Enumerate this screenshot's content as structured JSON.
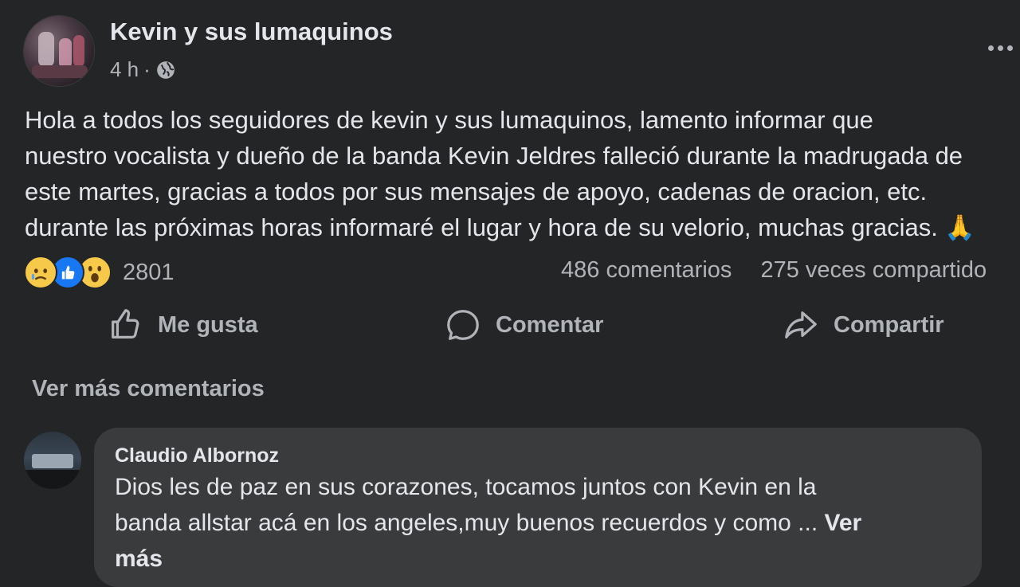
{
  "post": {
    "author": "Kevin y sus lumaquinos",
    "time": "4 h",
    "separator": "·",
    "audience_icon": "globe-icon",
    "more_icon": "ellipsis-icon",
    "text_lines": [
      "Hola a todos los seguidores de kevin y sus lumaquinos, lamento informar que",
      "nuestro vocalista y dueño de la banda Kevin Jeldres falleció durante la madrugada de",
      "este martes, gracias a todos por sus mensajes de apoyo, cadenas de oracion, etc.",
      "durante las próximas horas informaré el lugar y hora de su velorio, muchas gracias. 🙏"
    ]
  },
  "reactions": {
    "icons": [
      "sad-emoji",
      "like-icon",
      "wow-emoji"
    ],
    "count": "2801",
    "comments": "486 comentarios",
    "shares": "275 veces compartido"
  },
  "actions": {
    "like": "Me gusta",
    "comment": "Comentar",
    "share": "Compartir"
  },
  "comments_section": {
    "more_comments": "Ver más comentarios",
    "comment": {
      "author": "Claudio Albornoz",
      "line1": "Dios les de paz en sus corazones, tocamos juntos con Kevin en la",
      "line2": "banda allstar acá en los angeles,muy buenos recuerdos y como ... ",
      "see_more_part1": "Ver",
      "see_more_part2": "más"
    }
  },
  "colors": {
    "background": "#242526",
    "text_primary": "#e4e6eb",
    "text_secondary": "#b0b3b8",
    "bubble": "#3a3b3c",
    "like_blue": "#1877f2"
  }
}
